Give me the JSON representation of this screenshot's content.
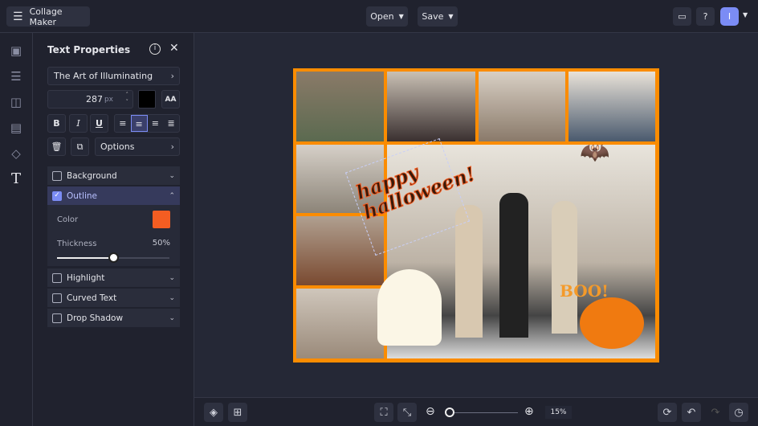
{
  "app": {
    "title": "Collage Maker",
    "menu_icon": "hamburger-icon"
  },
  "header": {
    "open": "Open",
    "save": "Save",
    "avatar": "I"
  },
  "rail": [
    "image-icon",
    "sliders-icon",
    "layout-icon",
    "texture-icon",
    "shapes-icon",
    "text-icon"
  ],
  "panel": {
    "title": "Text Properties",
    "font": "The Art of Illuminating",
    "size": "287",
    "size_unit": "px",
    "text_color": "#000000",
    "options": "Options",
    "sections": [
      {
        "label": "Background",
        "checked": false
      },
      {
        "label": "Outline",
        "checked": true
      },
      {
        "label": "Highlight",
        "checked": false
      },
      {
        "label": "Curved Text",
        "checked": false
      },
      {
        "label": "Drop Shadow",
        "checked": false
      }
    ],
    "outline": {
      "color_label": "Color",
      "color": "#f45d22",
      "thickness_label": "Thickness",
      "thickness": "50%",
      "thickness_value": 50
    }
  },
  "canvas": {
    "text": "happy halloween!",
    "boo": "BOO!",
    "border_color": "#fb8c00"
  },
  "zoom": {
    "value": "15%",
    "level": 15
  }
}
